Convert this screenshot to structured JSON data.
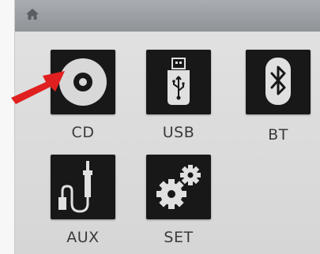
{
  "header": {
    "home_icon": "home-icon"
  },
  "menu": {
    "items": [
      {
        "label": "CD",
        "icon": "cd-icon"
      },
      {
        "label": "USB",
        "icon": "usb-icon"
      },
      {
        "label": "BT",
        "icon": "bluetooth-icon"
      },
      {
        "label": "AUX",
        "icon": "aux-cable-icon"
      },
      {
        "label": "SET",
        "icon": "gears-icon"
      }
    ]
  },
  "callout": {
    "icon": "red-arrow-icon",
    "color": "#e02020"
  },
  "colors": {
    "tile": "#181818",
    "topbar": "#9a9ea2",
    "background": "#dcdcdc"
  }
}
